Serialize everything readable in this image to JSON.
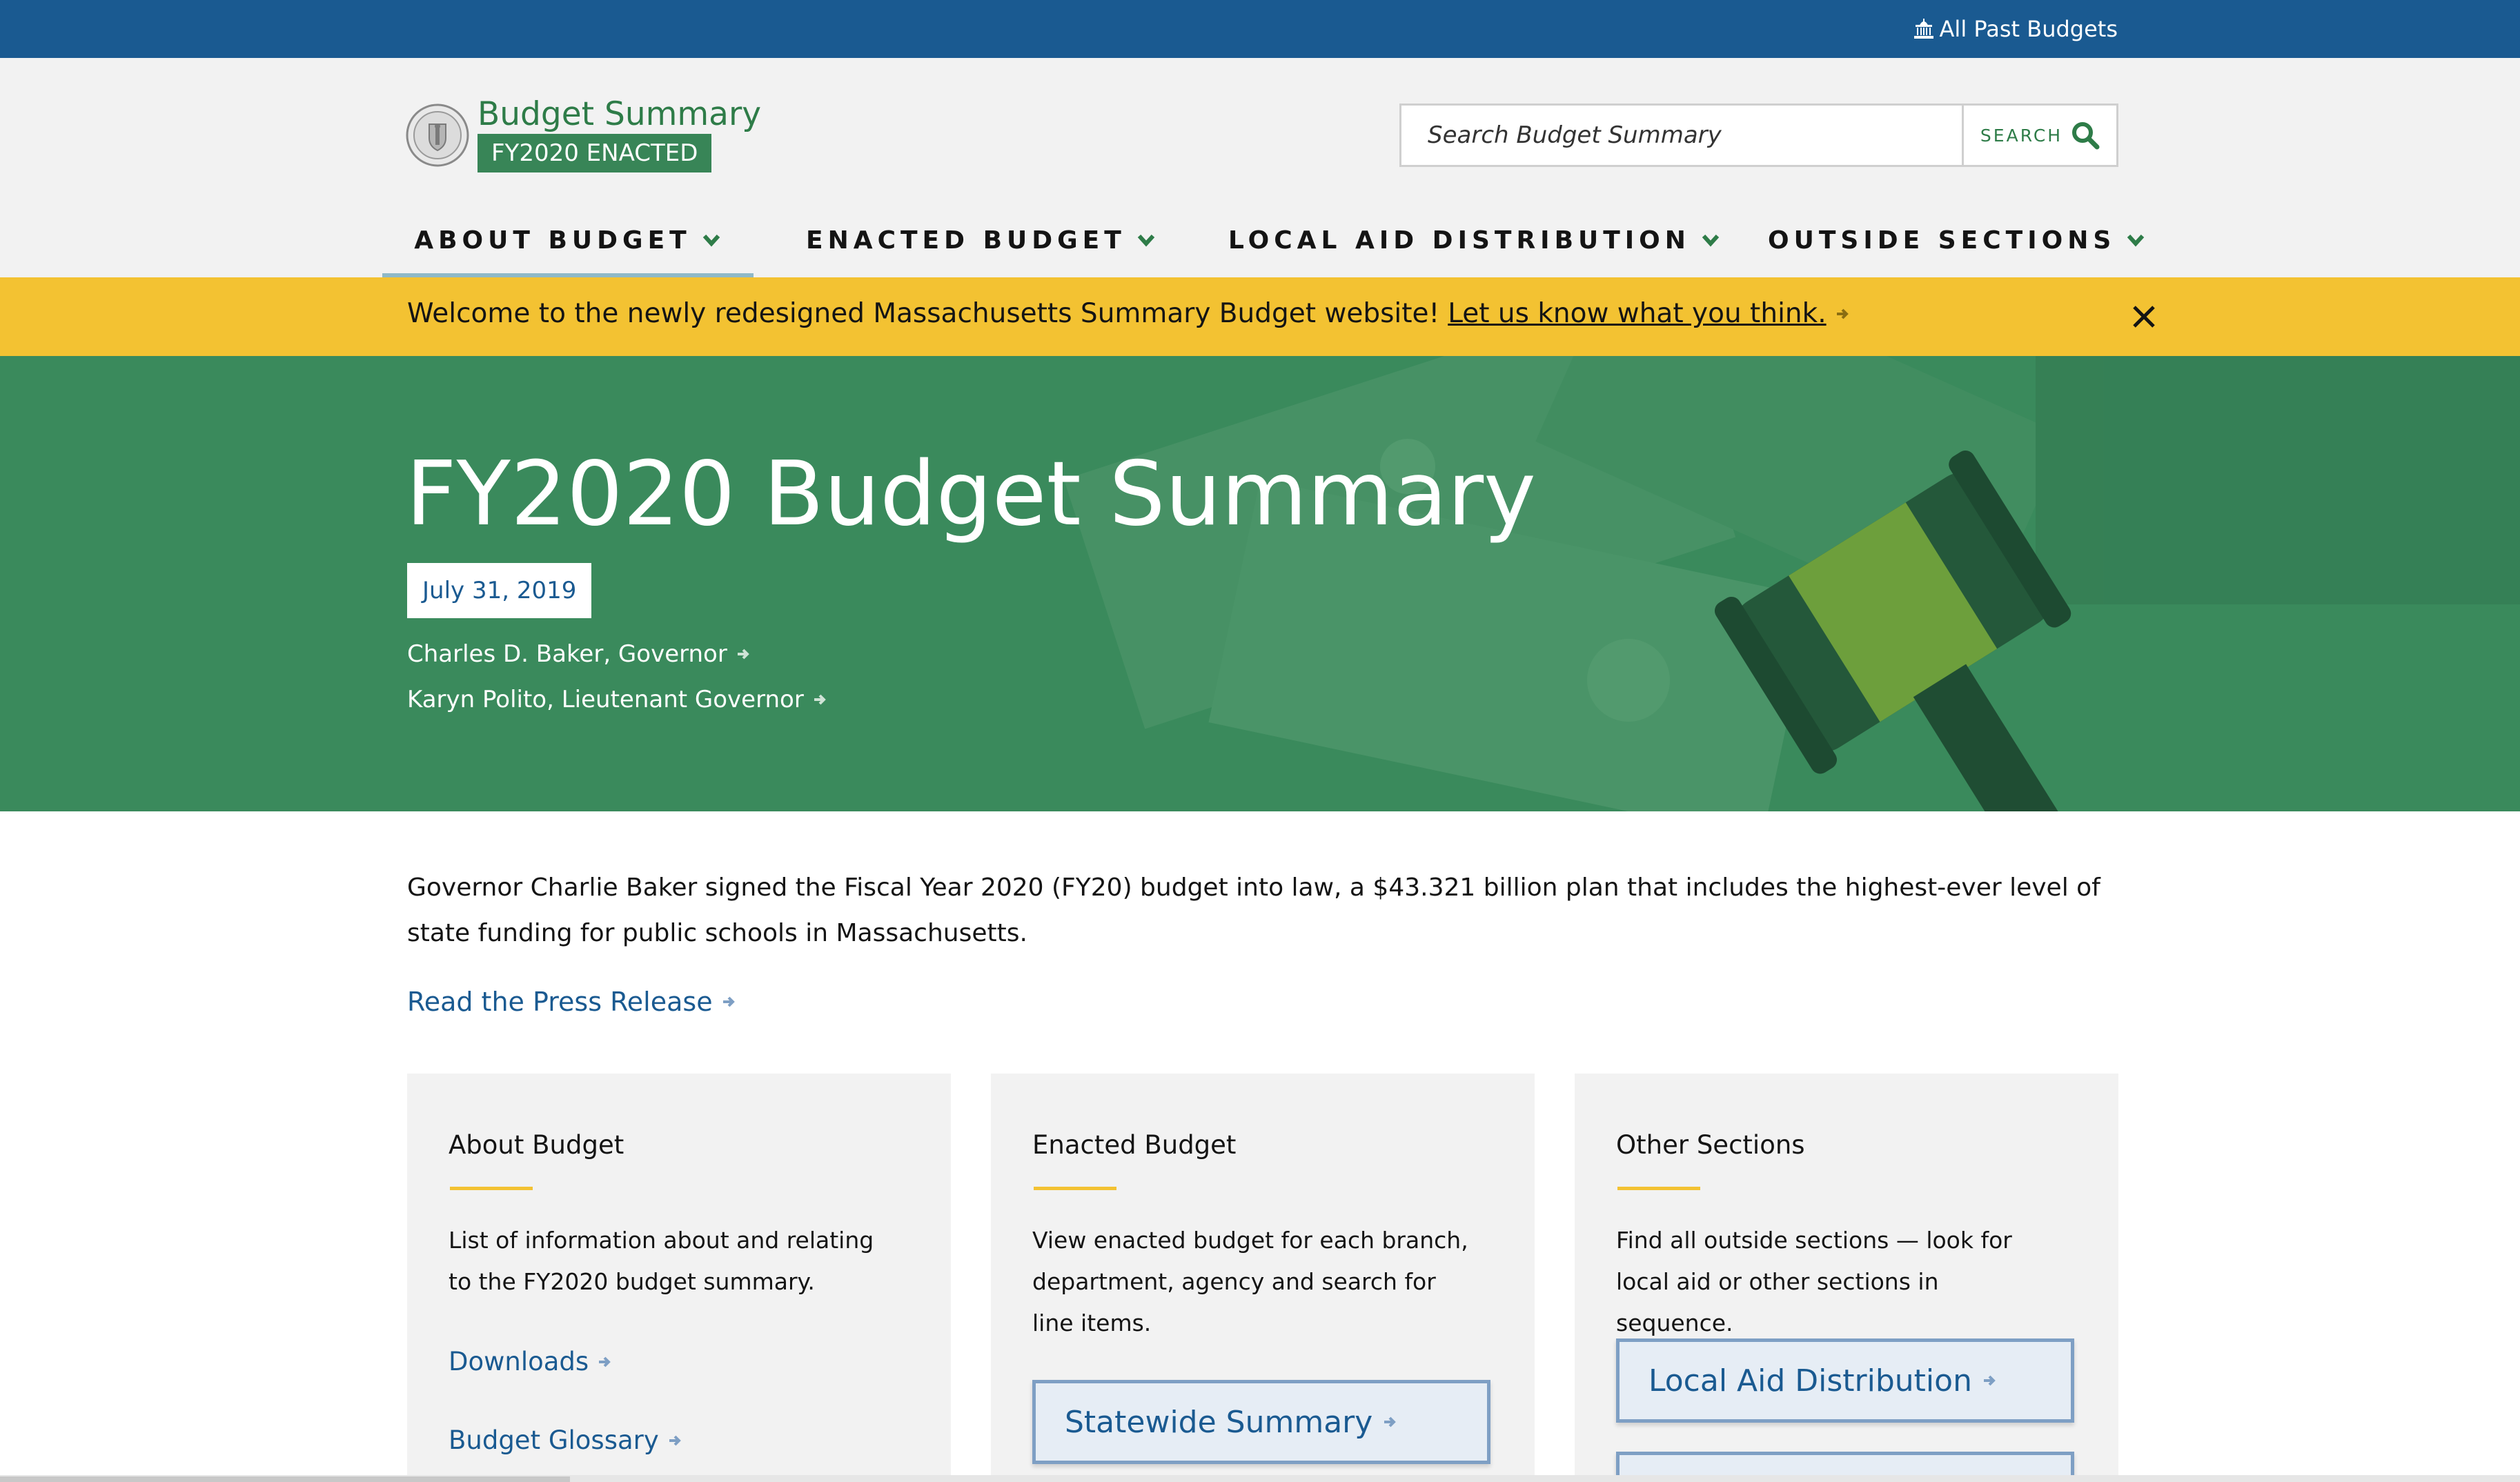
{
  "utility_bar": {
    "link_label": "All Past Budgets"
  },
  "header": {
    "site_title": "Budget Summary",
    "badge": "FY2020 ENACTED",
    "search": {
      "placeholder": "Search Budget Summary",
      "button_label": "SEARCH"
    }
  },
  "nav": [
    {
      "label": "ABOUT BUDGET",
      "active": true
    },
    {
      "label": "ENACTED BUDGET",
      "active": false
    },
    {
      "label": "LOCAL AID DISTRIBUTION",
      "active": false
    },
    {
      "label": "OUTSIDE SECTIONS",
      "active": false
    }
  ],
  "alert": {
    "text": "Welcome to the newly redesigned Massachusetts Summary Budget website!",
    "link_label": "Let us know what you think."
  },
  "hero": {
    "title": "FY2020 Budget Summary",
    "date": "July 31, 2019",
    "links": [
      "Charles D. Baker, Governor",
      "Karyn Polito, Lieutenant Governor"
    ]
  },
  "intro": {
    "text": "Governor Charlie Baker signed the Fiscal Year 2020 (FY20) budget into law, a $43.321 billion plan that includes the highest-ever level of state funding for public schools in Massachusetts.",
    "press_link": "Read the Press Release"
  },
  "cards": [
    {
      "title": "About Budget",
      "description": "List of information about and relating to the FY2020 budget summary.",
      "links": [
        "Downloads",
        "Budget Glossary"
      ]
    },
    {
      "title": "Enacted Budget",
      "description": "View enacted budget for each branch, department, agency and search for line items.",
      "buttons": [
        "Statewide Summary"
      ]
    },
    {
      "title": "Other Sections",
      "description": "Find all outside sections — look for local aid or other sections in sequence.",
      "buttons": [
        "Local Aid Distribution",
        ""
      ]
    }
  ],
  "colors": {
    "utility_blue": "#1a5a91",
    "brand_green": "#2e7c48",
    "hero_green": "#3a8a5c",
    "alert_yellow": "#f3c232",
    "link_blue": "#1a5a91"
  },
  "icons": {
    "past_budgets": "capitol-building-icon",
    "search": "search-icon",
    "nav_chevron": "chevron-down-icon",
    "close": "close-icon",
    "link_arrow": "arrow-right-icon"
  }
}
